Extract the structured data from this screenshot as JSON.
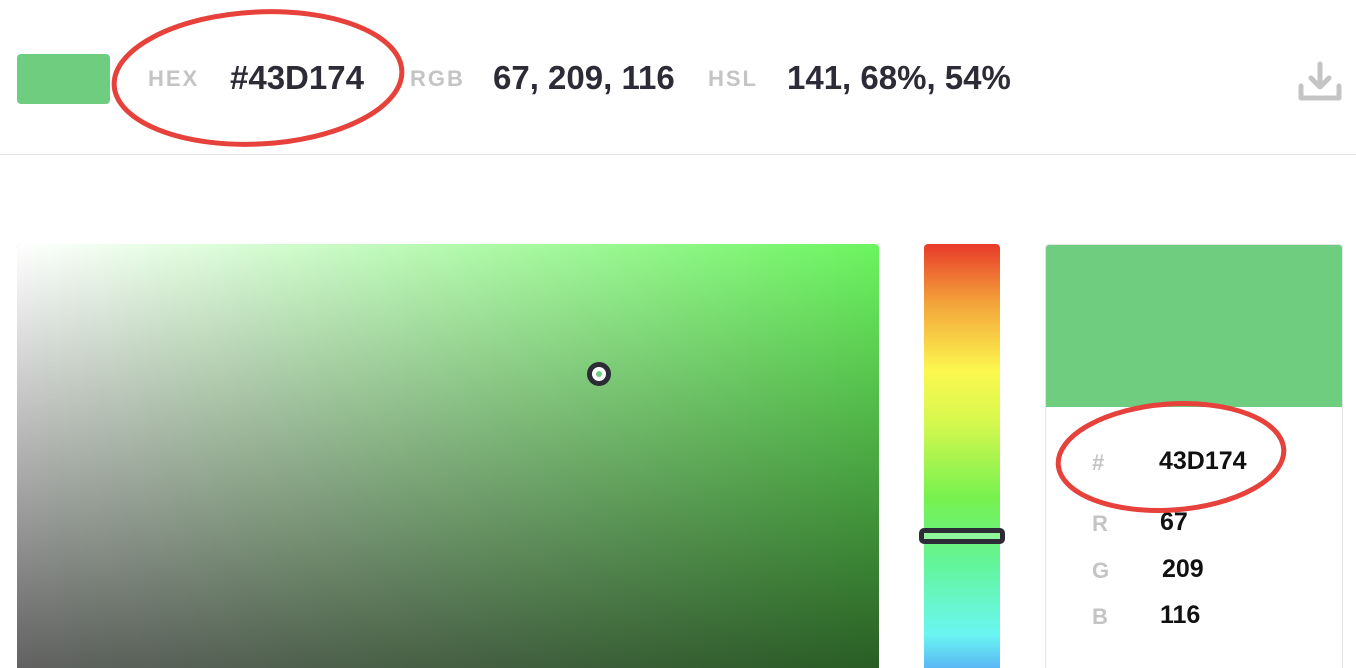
{
  "color": {
    "hex": "#6FCD80",
    "marker": "#43D174"
  },
  "header": {
    "hex_label": "HEX",
    "hex_value": "#43D174",
    "rgb_label": "RGB",
    "rgb_value": "67, 209, 116",
    "hsl_label": "HSL",
    "hsl_value": "141, 68%, 54%"
  },
  "panel": {
    "hex_label": "#",
    "hex_value": "43D174",
    "r_label": "R",
    "r_value": "67",
    "g_label": "G",
    "g_value": "209",
    "b_label": "B",
    "b_value": "116"
  },
  "annotation": {
    "color": "#E6413A"
  },
  "icons": {
    "download": "download-icon"
  }
}
